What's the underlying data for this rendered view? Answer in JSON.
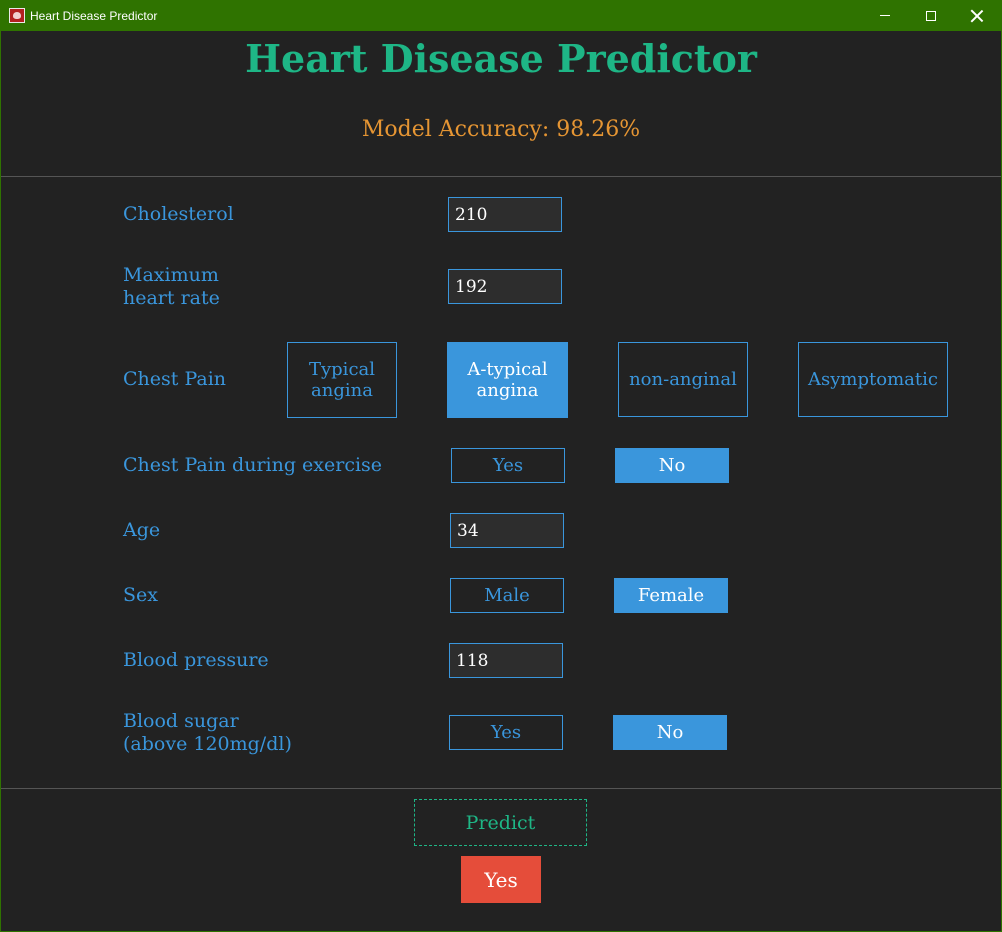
{
  "window": {
    "title": "Heart Disease Predictor"
  },
  "header": {
    "title": "Heart Disease Predictor",
    "accuracy": "Model Accuracy: 98.26%"
  },
  "form": {
    "cholesterol": {
      "label": "Cholesterol",
      "value": "210"
    },
    "max_heart_rate": {
      "label_line1": "Maximum",
      "label_line2": "heart rate",
      "value": "192"
    },
    "chest_pain": {
      "label": "Chest Pain",
      "options": [
        {
          "line1": "Typical",
          "line2": "angina"
        },
        {
          "line1": "A-typical",
          "line2": "angina"
        },
        {
          "line1": "non-anginal",
          "line2": ""
        },
        {
          "line1": "Asymptomatic",
          "line2": ""
        }
      ],
      "selected": "A-typical angina"
    },
    "exercise_pain": {
      "label": "Chest Pain during exercise",
      "yes_label": "Yes",
      "no_label": "No",
      "selected": "No"
    },
    "age": {
      "label": "Age",
      "value": "34"
    },
    "sex": {
      "label": "Sex",
      "male_label": "Male",
      "female_label": "Female",
      "selected": "Female"
    },
    "blood_pressure": {
      "label": "Blood pressure",
      "value": "118"
    },
    "blood_sugar": {
      "label_line1": "Blood sugar",
      "label_line2": "(above 120mg/dl)",
      "yes_label": "Yes",
      "no_label": "No",
      "selected": "No"
    }
  },
  "actions": {
    "predict_label": "Predict",
    "result": "Yes"
  },
  "colors": {
    "accent_blue": "#3a96dc",
    "title_green": "#1eb686",
    "accuracy_orange": "#e59533",
    "result_red": "#e54d3a",
    "titlebar_green": "#2f7300"
  }
}
